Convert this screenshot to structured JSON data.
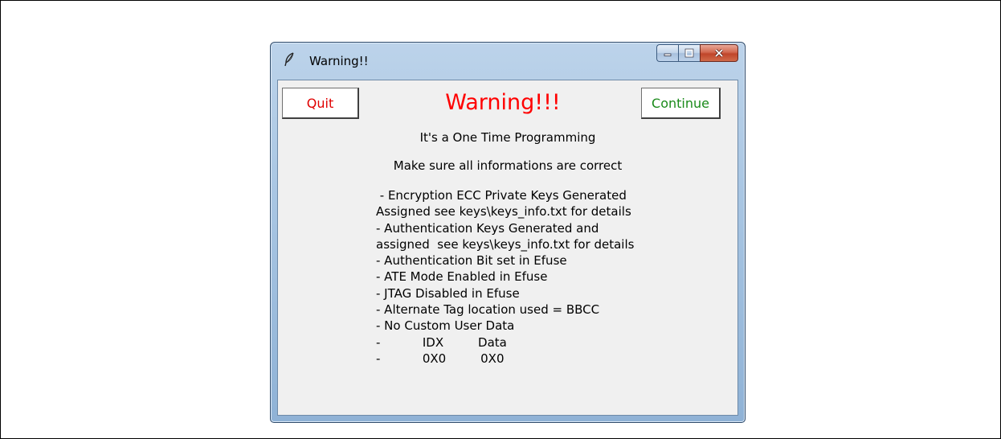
{
  "window": {
    "title": "Warning!!",
    "icon": "feather-icon",
    "controls": [
      "minimize-icon",
      "maximize-icon",
      "close-icon"
    ]
  },
  "dialog": {
    "quit_label": "Quit",
    "heading": "Warning!!!",
    "continue_label": "Continue",
    "line1": "It's a One Time Programming",
    "line2": "Make sure all informations are correct",
    "details": [
      " - Encryption ECC Private Keys Generated",
      "Assigned see keys\\keys_info.txt for details",
      "- Authentication Keys Generated and",
      "assigned  see keys\\keys_info.txt for details",
      "- Authentication Bit set in Efuse",
      "- ATE Mode Enabled in Efuse",
      "- JTAG Disabled in Efuse",
      "- Alternate Tag location used = BBCC",
      "- No Custom User Data",
      "-           IDX         Data",
      "-           0X0         0X0"
    ]
  },
  "colors": {
    "quit_text": "#e00000",
    "heading": "#ff0000",
    "continue_text": "#1a8a1a"
  }
}
